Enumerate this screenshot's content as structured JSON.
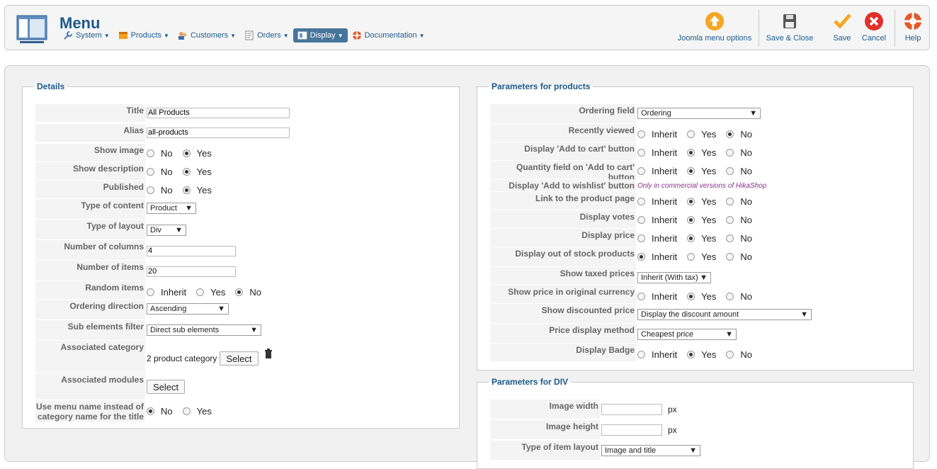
{
  "app": {
    "title": "Menu"
  },
  "nav": [
    {
      "label": "System",
      "icon": "wrench-icon"
    },
    {
      "label": "Products",
      "icon": "products-icon"
    },
    {
      "label": "Customers",
      "icon": "customers-icon"
    },
    {
      "label": "Orders",
      "icon": "orders-icon"
    },
    {
      "label": "Display",
      "icon": "display-icon",
      "active": true
    },
    {
      "label": "Documentation",
      "icon": "lifebuoy-icon"
    }
  ],
  "toolbar": {
    "joomla": "Joomla menu options",
    "save_close": "Save & Close",
    "save": "Save",
    "cancel": "Cancel",
    "help": "Help"
  },
  "details": {
    "legend": "Details",
    "title_label": "Title",
    "title_value": "All Products",
    "alias_label": "Alias",
    "alias_value": "all-products",
    "show_image_label": "Show image",
    "show_description_label": "Show description",
    "published_label": "Published",
    "no": "No",
    "yes": "Yes",
    "inherit": "Inherit",
    "type_content_label": "Type of content",
    "type_content_value": "Product",
    "type_layout_label": "Type of layout",
    "type_layout_value": "Div",
    "columns_label": "Number of columns",
    "columns_value": "4",
    "items_label": "Number of items",
    "items_value": "20",
    "random_label": "Random items",
    "ordering_dir_label": "Ordering direction",
    "ordering_dir_value": "Ascending",
    "sub_filter_label": "Sub elements filter",
    "sub_filter_value": "Direct sub elements",
    "assoc_cat_label": "Associated category",
    "assoc_cat_value": "2 product category",
    "select": "Select",
    "assoc_mod_label": "Associated modules",
    "menu_name_label_1": "Use menu name instead of",
    "menu_name_label_2": "category name for the title"
  },
  "products": {
    "legend": "Parameters for products",
    "ordering_field_label": "Ordering field",
    "ordering_field_value": "Ordering",
    "recent_label": "Recently viewed",
    "add_cart_label": "Display 'Add to cart' button",
    "qty_label": "Quantity field on 'Add to cart' button",
    "wishlist_label": "Display 'Add to wishlist' button",
    "wishlist_note": "Only in commercial versions of HikaShop",
    "link_label": "Link to the product page",
    "votes_label": "Display votes",
    "price_label": "Display price",
    "oos_label": "Display out of stock products",
    "taxed_label": "Show taxed prices",
    "taxed_value": "Inherit (With tax)",
    "orig_cur_label": "Show price in original currency",
    "discount_label": "Show discounted price",
    "discount_value": "Display the discount amount",
    "method_label": "Price display method",
    "method_value": "Cheapest price",
    "badge_label": "Display Badge",
    "inherit": "Inherit",
    "yes": "Yes",
    "no": "No"
  },
  "div": {
    "legend": "Parameters for DIV",
    "width_label": "Image width",
    "height_label": "Image height",
    "px": "px",
    "item_layout_label": "Type of item layout",
    "item_layout_value": "Image and title"
  },
  "colors": {
    "accent": "#1c5a8c",
    "active_nav": "#46759b"
  }
}
